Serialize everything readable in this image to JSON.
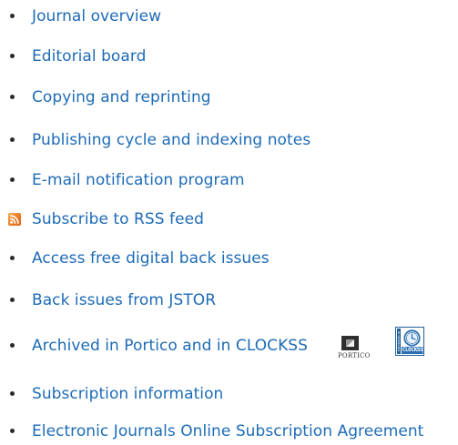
{
  "links": [
    {
      "label": "Journal overview"
    },
    {
      "label": "Editorial board"
    },
    {
      "label": "Copying and reprinting"
    },
    {
      "label": "Publishing cycle and indexing notes"
    },
    {
      "label": "E-mail notification program"
    },
    {
      "label": "Subscribe to RSS feed",
      "icon": "rss-feed-icon"
    },
    {
      "label": "Access free digital back issues"
    },
    {
      "label": "Back issues from JSTOR"
    },
    {
      "label": "Archived in Portico and in CLOCKSS"
    },
    {
      "label": "Subscription information"
    },
    {
      "label": "Electronic Journals Online Subscription Agreement"
    }
  ],
  "badges": {
    "portico_label": "PORTICO",
    "clockss_label": "CLOCKSS",
    "clockss_side_label": "PRESERVED IN"
  },
  "colors": {
    "link": "#1d6bb7",
    "bullet": "#2b2b2b",
    "rss": "#ee7b22",
    "clockss": "#2a6fb0"
  }
}
